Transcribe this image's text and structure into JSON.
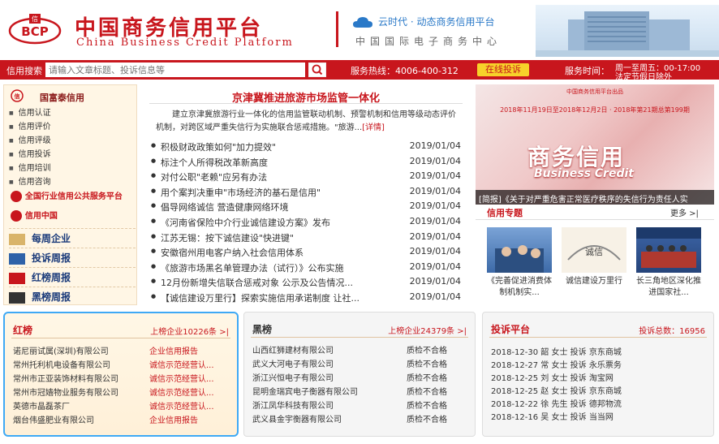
{
  "header": {
    "title_cn": "中国商务信用平台",
    "title_en": "China Business Credit Platform",
    "logo_text": "BCP",
    "slogan": "云时代 · 动态商务信用平台",
    "center_name": "中国国际电子商务中心"
  },
  "navbar": {
    "search_label": "信用搜索",
    "search_placeholder": "请输入文章标题、投诉信息等",
    "hotline": "服务热线：4006-400-312",
    "online_label": "在线投诉",
    "service_label": "服务时间：",
    "service_time1": "周一至周五：00-17:00",
    "service_time2": "法定节假日除外"
  },
  "sidebar": {
    "section_title": "国富泰信用",
    "items": [
      "信用认证",
      "信用评价",
      "信用评级",
      "信用投诉",
      "信用培训",
      "信用咨询"
    ],
    "link1": "全国行业信用公共服务平台",
    "link2": "信用中国",
    "weekly": [
      "每周企业",
      "投诉周报",
      "红榜周报",
      "黑榜周报"
    ]
  },
  "news": {
    "headline": "京津冀推进旅游市场监管一体化",
    "summary": "建立京津冀旅游行业一体化的信用监管联动机制、预警机制和信用等级动态评价机制，对跨区域严重失信行为实施联合惩戒措施。\"旅游...",
    "more": "[详情]",
    "items": [
      {
        "title": "积极财政政策如何\"加力提效\"",
        "date": "2019/01/04"
      },
      {
        "title": "标注个人所得税改革新高度",
        "date": "2019/01/04"
      },
      {
        "title": "对付公职\"老赖\"应另有办法",
        "date": "2019/01/04"
      },
      {
        "title": "用个案判决重申\"市场经济的基石是信用\"",
        "date": "2019/01/04"
      },
      {
        "title": "倡导网络诚信 营造健康网络环境",
        "date": "2019/01/04"
      },
      {
        "title": "《河南省保险中介行业诚信建设方案》发布",
        "date": "2019/01/04"
      },
      {
        "title": "江苏无锡：按下诚信建设\"快进键\"",
        "date": "2019/01/04"
      },
      {
        "title": "安徽宿州用电客户纳入社会信用体系",
        "date": "2019/01/04"
      },
      {
        "title": "《旅游市场黑名单管理办法（试行）》公布实施",
        "date": "2019/01/04"
      },
      {
        "title": "12月份新增失信联合惩戒对象 公示及公告情况...",
        "date": "2019/01/04"
      },
      {
        "title": "【诚信建设万里行】探索实施信用承诺制度 让社...",
        "date": "2019/01/04"
      }
    ]
  },
  "slider": {
    "top": "中国商务信用平台出品",
    "dates": "2018年11月19日至2018年12月2日 · 2018年第21期总第199期",
    "cn": "商务信用",
    "en": "Business Credit",
    "caption": "[简报]《关于对严重危害正常医疗秩序的失信行为责任人实"
  },
  "topics": {
    "head": "信用专题",
    "more": "更多 >|",
    "items": [
      {
        "caption": "《完善促进消费体制机制实..."
      },
      {
        "caption": "诚信建设万里行"
      },
      {
        "caption": "长三角地区深化推进国家社..."
      }
    ]
  },
  "red_list": {
    "title": "红榜",
    "count": "上榜企业10226条 >|",
    "rows": [
      {
        "name": "诺尼丽试属(深圳)有限公司",
        "status": "企业信用报告"
      },
      {
        "name": "常州托利机电设备有限公司",
        "status": "诚信示范经营认..."
      },
      {
        "name": "常州市正亚装饰材料有限公司",
        "status": "诚信示范经营认..."
      },
      {
        "name": "常州市冠嫱物业服务有限公司",
        "status": "诚信示范经营认..."
      },
      {
        "name": "英德市晶磊茶厂",
        "status": "诚信示范经营认..."
      },
      {
        "name": "烟台伟盛肥业有限公司",
        "status": "企业信用报告"
      }
    ]
  },
  "black_list": {
    "title": "黑榜",
    "count": "上榜企业24379条 >|",
    "rows": [
      {
        "name": "山西红狮建材有限公司",
        "status": "质检不合格"
      },
      {
        "name": "武义大河电子有限公司",
        "status": "质检不合格"
      },
      {
        "name": "浙江兴恒电子有限公司",
        "status": "质检不合格"
      },
      {
        "name": "昆明金瑞宾电子衡器有限公司",
        "status": "质检不合格"
      },
      {
        "name": "浙江凤华科技有限公司",
        "status": "质检不合格"
      },
      {
        "name": "武义县金宇衡器有限公司",
        "status": "质检不合格"
      }
    ]
  },
  "complaints": {
    "title": "投诉平台",
    "count": "投诉总数：16956",
    "rows": [
      {
        "text": "2018-12-30 韶 女士 投诉 京东商城"
      },
      {
        "text": "2018-12-27 常 女士 投诉 永乐票务"
      },
      {
        "text": "2018-12-25 刘 女士 投诉 淘宝网"
      },
      {
        "text": "2018-12-25 赵 女士 投诉 京东商城"
      },
      {
        "text": "2018-12-22 徐 先生 投诉 德邦物流"
      },
      {
        "text": "2018-12-16 吴 女士 投诉 当当网"
      }
    ]
  },
  "colors": {
    "brand_red": "#c8161d",
    "accent_blue": "#2a79c8",
    "highlight": "#3fa9f5"
  }
}
